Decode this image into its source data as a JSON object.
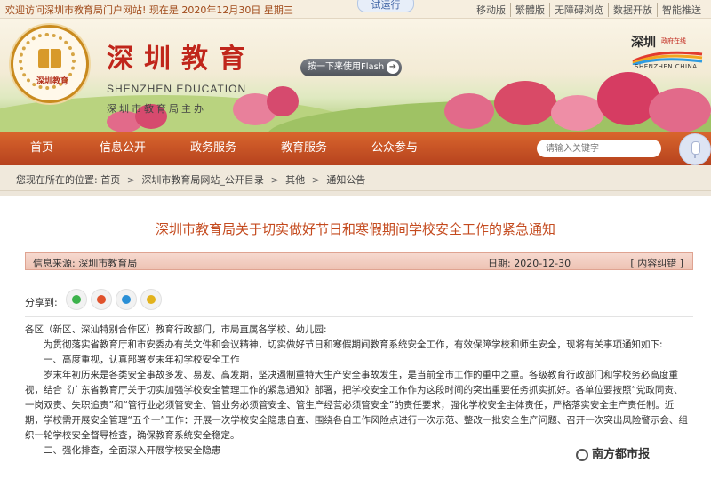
{
  "topbar": {
    "welcome": "欢迎访问深圳市教育局门户网站! 现在是 2020年12月30日 星期三",
    "trial": "试运行",
    "links": [
      "移动版",
      "繁體版",
      "无障碍浏览",
      "数据开放",
      "智能推送"
    ]
  },
  "header": {
    "emblem_text": "深圳教育",
    "title_cn": "深圳教育",
    "title_en": "SHENZHEN EDUCATION",
    "title_sub": "深圳市教育局主办",
    "flash_button": "按一下来使用Flash",
    "flash_arrow": "➜",
    "city_logo_cn": "深圳",
    "city_logo_small": "政府在线",
    "city_logo_en": "SHENZHEN CHINA"
  },
  "nav": {
    "items": [
      "首页",
      "信息公开",
      "政务服务",
      "教育服务",
      "公众参与"
    ],
    "search_placeholder": "请输入关键字"
  },
  "breadcrumb": {
    "prefix": "您现在所在的位置:",
    "items": [
      "首页",
      "深圳市教育局网站_公开目录",
      "其他",
      "通知公告"
    ],
    "separator": ">"
  },
  "article": {
    "title": "深圳市教育局关于切实做好节日和寒假期间学校安全工作的紧急通知",
    "source": "信息来源:   深圳市教育局",
    "date": "日期:  2020-12-30",
    "correction": "[ 内容纠错 ]",
    "share_label": "分享到:",
    "paragraphs": [
      "各区（新区、深汕特别合作区）教育行政部门，市局直属各学校、幼儿园:",
      "　　为贯彻落实省教育厅和市安委办有关文件和会议精神，切实做好节日和寒假期间教育系统安全工作，有效保障学校和师生安全，现将有关事项通知如下:",
      "　　一、高度重视，认真部署岁末年初学校安全工作",
      "　　岁末年初历来是各类安全事故多发、易发、高发期，坚决遏制重特大生产安全事故发生，是当前全市工作的重中之重。各级教育行政部门和学校务必高度重视，结合《广东省教育厅关于切实加强学校安全管理工作的紧急通知》部署，把学校安全工作作为这段时间的突出重要任务抓实抓好。各单位要按照“党政同责、一岗双责、失职追责”和“管行业必须管安全、管业务必须管安全、管生产经营必须管安全”的责任要求，强化学校安全主体责任，严格落实安全生产责任制。近期，学校需开展安全管理“五个一”工作：开展一次学校安全隐患自查、围绕各自工作风险点进行一次示范、整改一批安全生产问题、召开一次突出风险警示会、组织一轮学校安全督导检查，确保教育系统安全稳定。",
      "　　二、强化排查，全面深入开展学校安全隐患"
    ]
  },
  "watermark": "南方都市报",
  "icons": {
    "share": [
      "wechat-icon",
      "weibo-icon",
      "qq-icon",
      "qzone-icon"
    ],
    "search": "microphone-icon"
  },
  "colors": {
    "nav": "#c4512a",
    "title": "#c44a1e",
    "brand_red": "#c0261b"
  }
}
